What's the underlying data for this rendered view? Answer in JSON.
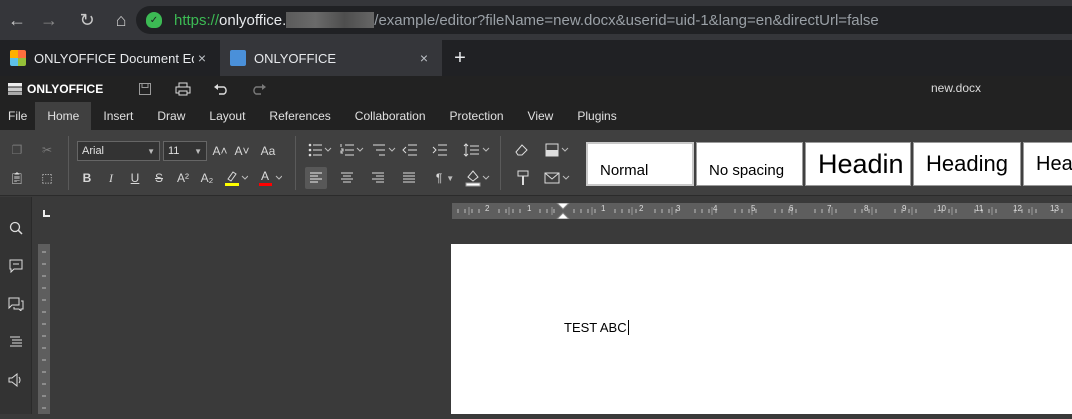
{
  "browser": {
    "nav": {
      "back": "←",
      "forward": "→",
      "reload": "↻",
      "home": "⌂"
    },
    "url": {
      "scheme": "https://",
      "host": "onlyoffice.",
      "path": "/example/editor?fileName=new.docx&userid=uid-1&lang=en&directUrl=false"
    },
    "tabs": [
      {
        "label": "ONLYOFFICE Document Ed",
        "close": "×"
      },
      {
        "label": "ONLYOFFICE",
        "close": "×"
      }
    ],
    "new_tab": "+"
  },
  "app": {
    "logo_text": "ONLYOFFICE",
    "doc_name": "new.docx",
    "menu": [
      "File",
      "Home",
      "Insert",
      "Draw",
      "Layout",
      "References",
      "Collaboration",
      "Protection",
      "View",
      "Plugins"
    ],
    "active_menu": "Home"
  },
  "toolbar": {
    "font_name": "Arial",
    "font_size": "11",
    "grow_font": "A˄",
    "shrink_font": "A˅",
    "change_case": "Aa",
    "bold": "B",
    "italic": "I",
    "underline": "U",
    "strikethrough": "S",
    "superscript": "A²",
    "subscript": "A₂",
    "highlight_color": "#ffff00",
    "font_color": "#ff0000",
    "nonprint_chars": "¶",
    "styles": [
      "Normal",
      "No spacing",
      "Headin",
      "Heading",
      "Hea"
    ]
  },
  "ruler": {
    "ticks": [
      "2",
      "1",
      "1",
      "2",
      "3",
      "4",
      "5",
      "6",
      "7",
      "8",
      "9",
      "10",
      "11",
      "12",
      "13"
    ]
  },
  "document": {
    "text": "TEST ABC"
  }
}
